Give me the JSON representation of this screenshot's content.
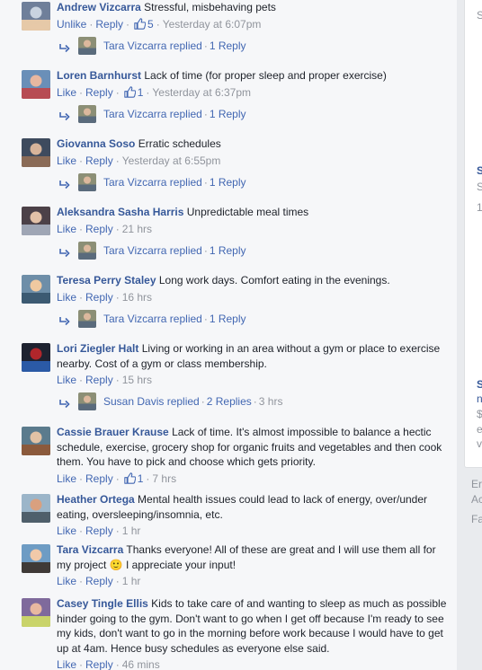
{
  "comments": [
    {
      "name": "Andrew Vizcarra",
      "text": "Stressful, misbehaving pets",
      "like_label": "Unlike",
      "reply_label": "Reply",
      "like_count": "5",
      "time": "Yesterday at 6:07pm",
      "reply": {
        "who": "Tara Vizcarra replied",
        "count": "1 Reply",
        "time": ""
      }
    },
    {
      "name": "Loren Barnhurst",
      "text": "Lack of time (for proper sleep and proper exercise)",
      "like_label": "Like",
      "reply_label": "Reply",
      "like_count": "1",
      "time": "Yesterday at 6:37pm",
      "reply": {
        "who": "Tara Vizcarra replied",
        "count": "1 Reply",
        "time": ""
      }
    },
    {
      "name": "Giovanna Soso",
      "text": "Erratic schedules",
      "like_label": "Like",
      "reply_label": "Reply",
      "like_count": "",
      "time": "Yesterday at 6:55pm",
      "reply": {
        "who": "Tara Vizcarra replied",
        "count": "1 Reply",
        "time": ""
      }
    },
    {
      "name": "Aleksandra Sasha Harris",
      "text": "Unpredictable meal times",
      "like_label": "Like",
      "reply_label": "Reply",
      "like_count": "",
      "time": "21 hrs",
      "reply": {
        "who": "Tara Vizcarra replied",
        "count": "1 Reply",
        "time": ""
      }
    },
    {
      "name": "Teresa Perry Staley",
      "text": "Long work days. Comfort eating in the evenings.",
      "like_label": "Like",
      "reply_label": "Reply",
      "like_count": "",
      "time": "16 hrs",
      "reply": {
        "who": "Tara Vizcarra replied",
        "count": "1 Reply",
        "time": ""
      }
    },
    {
      "name": "Lori Ziegler Halt",
      "text": "Living or working in an area without a gym or place to exercise nearby. Cost of a gym or class membership.",
      "like_label": "Like",
      "reply_label": "Reply",
      "like_count": "",
      "time": "15 hrs",
      "reply": {
        "who": "Susan Davis replied",
        "count": "2 Replies",
        "time": "3 hrs"
      }
    },
    {
      "name": "Cassie Brauer Krause",
      "text": "Lack of time. It's almost impossible to balance a hectic schedule, exercise, grocery shop for organic fruits and vegetables and then cook them. You have to pick and choose which gets priority.",
      "like_label": "Like",
      "reply_label": "Reply",
      "like_count": "1",
      "time": "7 hrs"
    },
    {
      "name": "Heather Ortega",
      "text": "Mental health issues could lead to lack of energy, over/under eating, oversleeping/insomnia, etc.",
      "like_label": "Like",
      "reply_label": "Reply",
      "like_count": "",
      "time": "1 hr"
    },
    {
      "name": "Tara Vizcarra",
      "text": "Thanks everyone! All of these are great and I will use them all for my project 🙂 I appreciate your input!",
      "like_label": "Like",
      "reply_label": "Reply",
      "like_count": "",
      "time": "1 hr"
    },
    {
      "name": "Casey Tingle Ellis",
      "text": "Kids to take care of and wanting to sleep as much as possible hinder going to the gym. Don't want to go when I get off because I'm ready to see my kids, don't want to go in the morning before work because I would have to get up at 4am. Hence busy schedules as everyone else said.",
      "like_label": "Like",
      "reply_label": "Reply",
      "like_count": "",
      "time": "46 mins"
    }
  ],
  "sidebar": {
    "fragments": [
      {
        "text": "S",
        "color": "#90949c",
        "weight": "normal"
      },
      {
        "text": "S",
        "color": "#365899",
        "weight": "bold"
      },
      {
        "text": "S",
        "color": "#90949c",
        "weight": "normal"
      },
      {
        "text": "1",
        "color": "#90949c",
        "weight": "normal"
      },
      {
        "text": "S",
        "color": "#365899",
        "weight": "bold"
      },
      {
        "text": "n",
        "color": "#365899",
        "weight": "normal"
      },
      {
        "text": "$",
        "color": "#90949c",
        "weight": "normal"
      },
      {
        "text": "e",
        "color": "#90949c",
        "weight": "normal"
      },
      {
        "text": "v",
        "color": "#90949c",
        "weight": "normal"
      },
      {
        "text": "Er",
        "color": "#90949c",
        "weight": "normal"
      },
      {
        "text": "Ac",
        "color": "#90949c",
        "weight": "normal"
      },
      {
        "text": "Fa",
        "color": "#90949c",
        "weight": "normal"
      }
    ]
  },
  "colors": {
    "link": "#365899",
    "action": "#4267b2",
    "meta": "#90949c",
    "bg": "#f6f7f9"
  },
  "icons": {
    "like": "thumbs-up-icon",
    "reply": "reply-arrow-icon"
  }
}
